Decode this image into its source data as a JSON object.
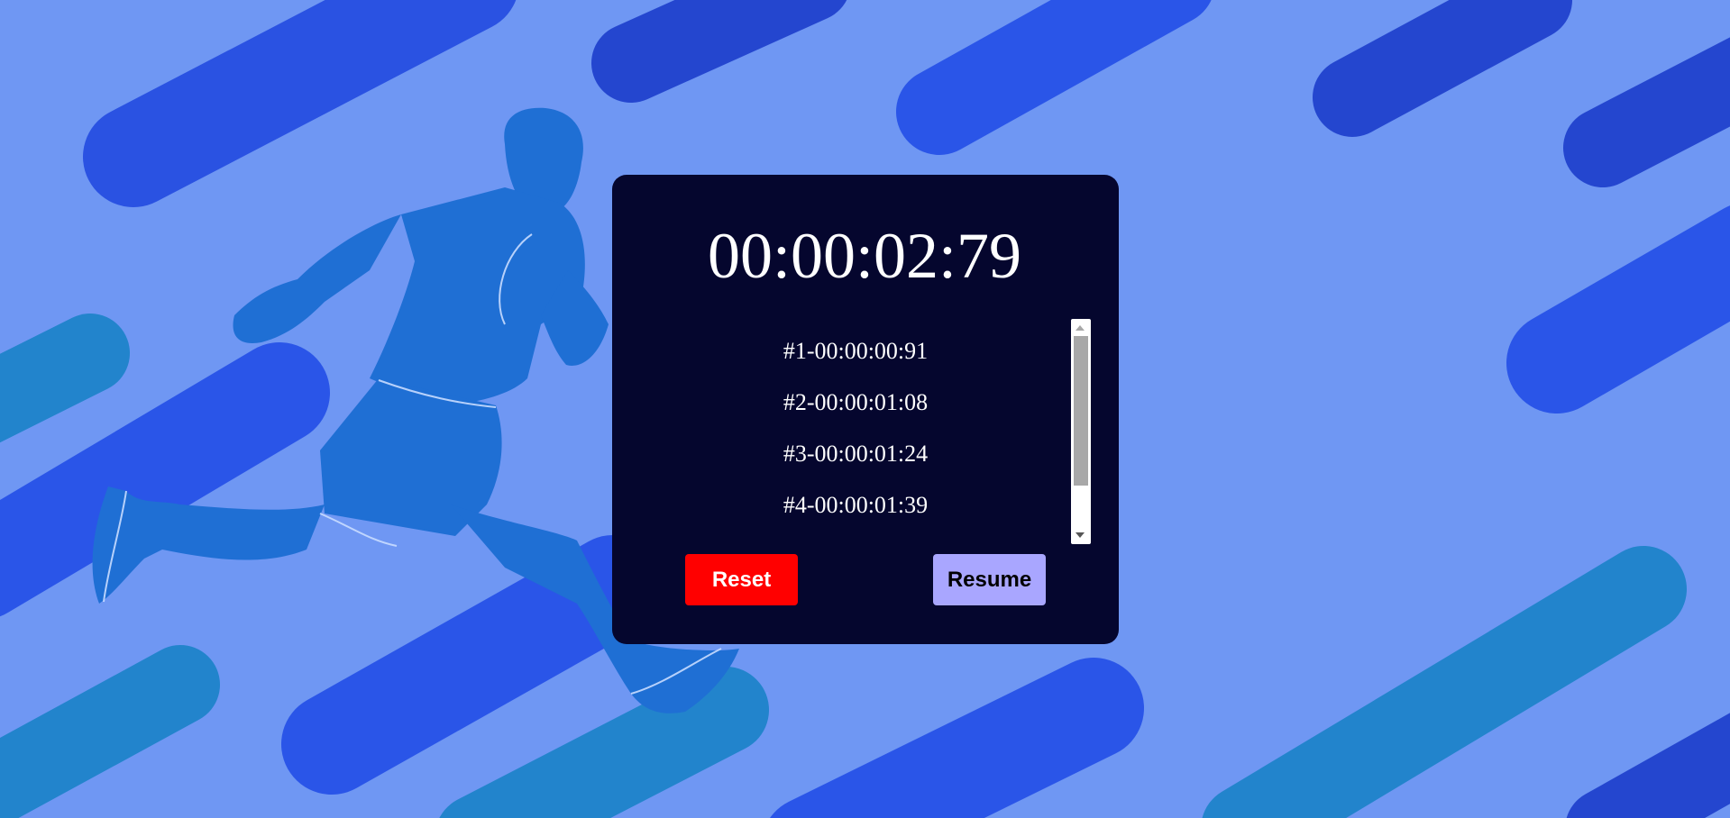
{
  "stopwatch": {
    "time": "00:00:02:79",
    "laps": [
      "#1-00:00:00:91",
      "#2-00:00:01:08",
      "#3-00:00:01:24",
      "#4-00:00:01:39"
    ],
    "reset_label": "Reset",
    "resume_label": "Resume"
  },
  "colors": {
    "background": "#6f97f3",
    "card": "#05062e",
    "reset_button": "#ff0000",
    "resume_button": "#a9a6ff",
    "stripe_blue": "#2a55e8",
    "stripe_teal": "#1e8ad2",
    "runner": "#1f6fd4"
  },
  "decor": {
    "background_art": "runner-illustration"
  }
}
